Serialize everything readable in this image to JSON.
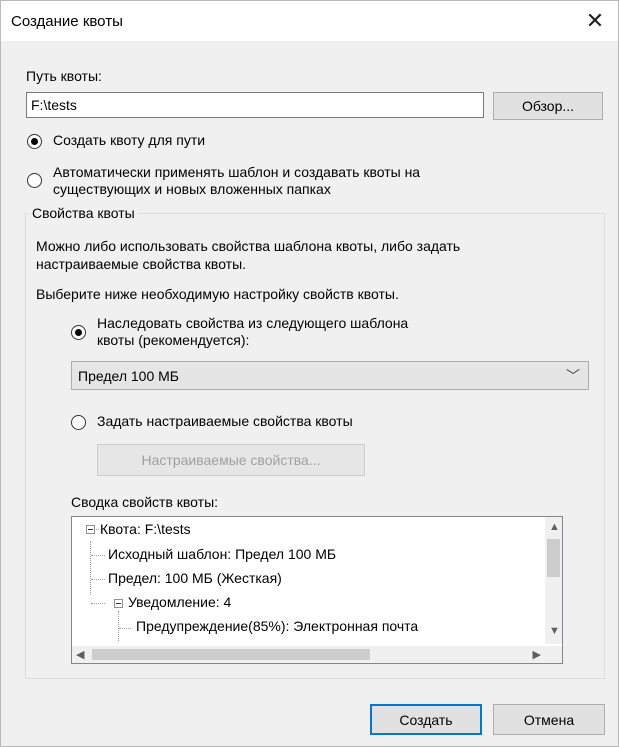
{
  "dialog": {
    "title": "Создание квоты",
    "close_glyph": "✕"
  },
  "path": {
    "label": "Путь квоты:",
    "value": "F:\\tests",
    "browse_label": "Обзор..."
  },
  "mode": {
    "create_for_path": "Создать квоту для пути",
    "auto_apply_line1": "Автоматически применять шаблон и создавать квоты на",
    "auto_apply_line2": "существующих и новых вложенных папках",
    "selected": "create_for_path"
  },
  "properties": {
    "group_title": "Свойства квоты",
    "desc_line1": "Можно либо использовать свойства шаблона квоты, либо задать",
    "desc_line2": "настраиваемые свойства квоты.",
    "desc_line3": "Выберите ниже необходимую настройку свойств квоты.",
    "inherit_line1": "Наследовать свойства из следующего шаблона",
    "inherit_line2": "квоты (рекомендуется):",
    "template_selected": "Предел 100 МБ",
    "custom_label": "Задать настраиваемые свойства квоты",
    "custom_button": "Настраиваемые свойства...",
    "selected": "inherit"
  },
  "summary": {
    "label": "Сводка свойств квоты:",
    "nodes": [
      "Квота: F:\\tests",
      "Исходный шаблон: Предел 100 МБ",
      "Предел: 100 МБ (Жесткая)",
      "Уведомление: 4",
      "Предупреждение(85%): Электронная почта"
    ]
  },
  "footer": {
    "create_label": "Создать",
    "cancel_label": "Отмена"
  },
  "icons": {
    "scroll_up": "▲",
    "scroll_down": "▼",
    "scroll_left": "◀",
    "scroll_right": "▶",
    "combo_arrow": "﹀"
  }
}
